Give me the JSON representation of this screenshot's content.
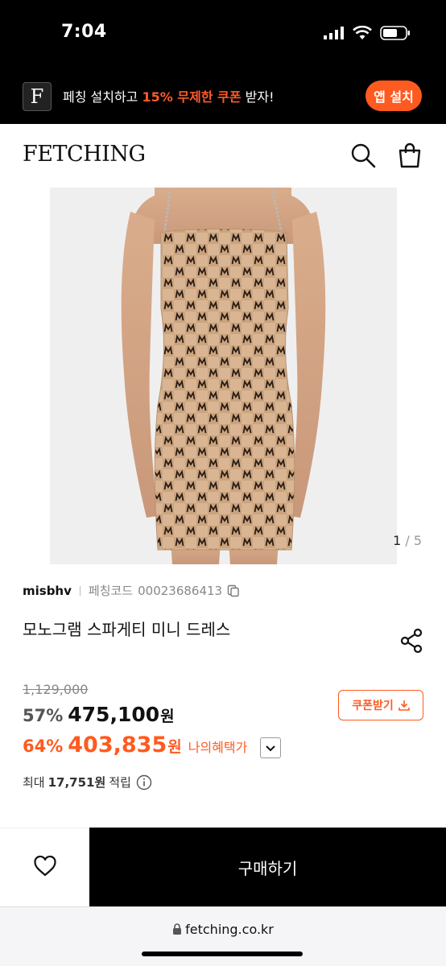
{
  "status_bar": {
    "time": "7:04"
  },
  "promo": {
    "logo_letter": "F",
    "text_pre": "페칭 설치하고 ",
    "text_highlight": "15% 무제한 쿠폰",
    "text_post": " 받자!",
    "install_label": "앱 설치"
  },
  "header": {
    "logo": "FETCHING",
    "icons": [
      "search-icon",
      "shopping-bag-icon"
    ]
  },
  "gallery": {
    "current": "1",
    "separator": " / ",
    "total": "5"
  },
  "product": {
    "brand": "misbhv",
    "code_label": "페칭코드",
    "code_value": "00023686413",
    "title": "모노그램 스파게티 미니 드레스",
    "original_price": "1,129,000",
    "discount_rate": "57%",
    "price": "475,100",
    "currency": "원",
    "benefit_rate": "64%",
    "benefit_price": "403,835",
    "benefit_label": "나의혜택가",
    "coupon_label": "쿠폰받기",
    "points_pre": "최대",
    "points_value": "17,751원",
    "points_post": "적립"
  },
  "actions": {
    "buy_label": "구매하기"
  },
  "browser": {
    "url": "fetching.co.kr"
  },
  "colors": {
    "accent": "#ff5a1f",
    "dress_base": "#d9b593",
    "monogram": "#2a1c14"
  }
}
